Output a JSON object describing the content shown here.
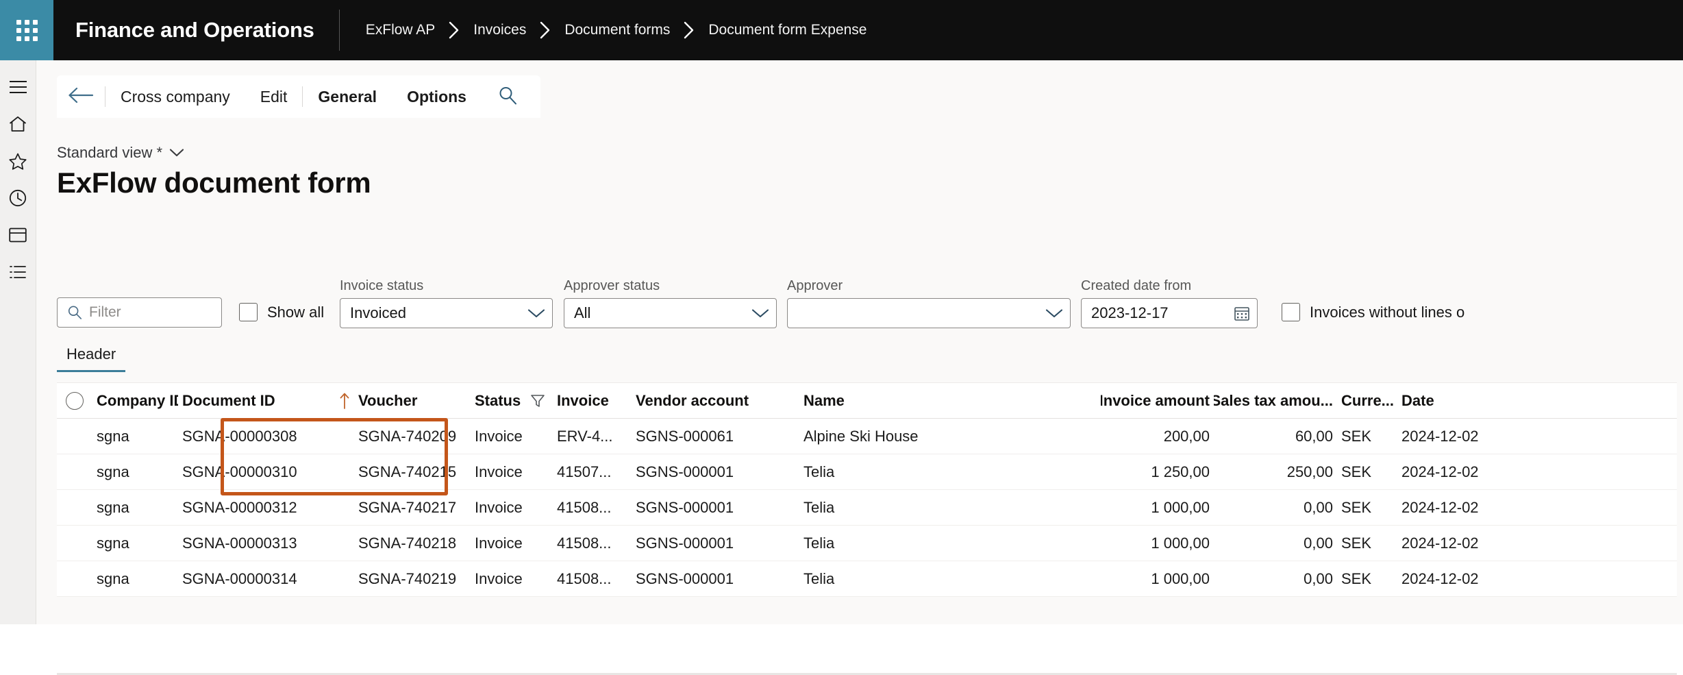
{
  "topbar": {
    "waffle_icon": "app-launcher-icon",
    "app_title": "Finance and Operations",
    "breadcrumb": [
      "ExFlow AP",
      "Invoices",
      "Document forms",
      "Document form Expense"
    ]
  },
  "rail": {
    "items": [
      {
        "name": "hamburger-icon",
        "label": "Expand navigation"
      },
      {
        "name": "home-icon",
        "label": "Home"
      },
      {
        "name": "star-icon",
        "label": "Favorites"
      },
      {
        "name": "clock-icon",
        "label": "Recent"
      },
      {
        "name": "workspaces-icon",
        "label": "Workspaces"
      },
      {
        "name": "modules-icon",
        "label": "Modules"
      }
    ]
  },
  "commandbar": {
    "back_icon": "back-arrow-icon",
    "items": [
      {
        "label": "Cross company",
        "bold": false
      },
      {
        "label": "Edit",
        "bold": false
      },
      {
        "label": "General",
        "bold": true
      },
      {
        "label": "Options",
        "bold": true
      }
    ],
    "search_icon": "search-icon"
  },
  "view": {
    "selector_label": "Standard view *",
    "chevron_icon": "chevron-down-icon",
    "page_title": "ExFlow document form"
  },
  "filters": {
    "filter_placeholder": "Filter",
    "filter_value": "",
    "filter_icon": "search-icon",
    "show_all_label": "Show all",
    "show_all_checked": false,
    "invoice_status": {
      "label": "Invoice status",
      "value": "Invoiced"
    },
    "approver_status": {
      "label": "Approver status",
      "value": "All"
    },
    "approver": {
      "label": "Approver",
      "value": ""
    },
    "created_date_from": {
      "label": "Created date from",
      "value": "2023-12-17",
      "icon": "calendar-icon"
    },
    "invoices_without_lines_label": "Invoices without lines o",
    "invoices_without_lines_checked": false
  },
  "tabs": [
    {
      "label": "Header",
      "active": true
    }
  ],
  "grid": {
    "columns": [
      "Company ID",
      "Document ID",
      "Voucher",
      "Status",
      "Invoice",
      "Vendor account",
      "Name",
      "Invoice amount",
      "Sales tax amou...",
      "Curre...",
      "Date"
    ],
    "sort_indicator_icon": "sort-ascending-icon",
    "status_filter_icon": "filter-funnel-icon",
    "select_all_icon": "radio-unselected-icon",
    "rows": [
      {
        "company_id": "sgna",
        "document_id": "SGNA-00000308",
        "voucher": "SGNA-740209",
        "status": "Invoiced",
        "invoice": "ERV-4...",
        "vendor_account": "SGNS-000061",
        "name": "Alpine Ski House",
        "invoice_amount": "200,00",
        "sales_tax_amount": "60,00",
        "currency": "SEK",
        "date": "2024-12-02"
      },
      {
        "company_id": "sgna",
        "document_id": "SGNA-00000310",
        "voucher": "SGNA-740215",
        "status": "Invoiced",
        "invoice": "41507...",
        "vendor_account": "SGNS-000001",
        "name": "Telia",
        "invoice_amount": "1 250,00",
        "sales_tax_amount": "250,00",
        "currency": "SEK",
        "date": "2024-12-02"
      },
      {
        "company_id": "sgna",
        "document_id": "SGNA-00000312",
        "voucher": "SGNA-740217",
        "status": "Invoiced",
        "invoice": "41508...",
        "vendor_account": "SGNS-000001",
        "name": "Telia",
        "invoice_amount": "1 000,00",
        "sales_tax_amount": "0,00",
        "currency": "SEK",
        "date": "2024-12-02"
      },
      {
        "company_id": "sgna",
        "document_id": "SGNA-00000313",
        "voucher": "SGNA-740218",
        "status": "Invoiced",
        "invoice": "41508...",
        "vendor_account": "SGNS-000001",
        "name": "Telia",
        "invoice_amount": "1 000,00",
        "sales_tax_amount": "0,00",
        "currency": "SEK",
        "date": "2024-12-02"
      },
      {
        "company_id": "sgna",
        "document_id": "SGNA-00000314",
        "voucher": "SGNA-740219",
        "status": "Invoiced",
        "invoice": "41508...",
        "vendor_account": "SGNS-000001",
        "name": "Telia",
        "invoice_amount": "1 000,00",
        "sales_tax_amount": "0,00",
        "currency": "SEK",
        "date": "2024-12-02"
      }
    ]
  },
  "annotation": {
    "highlight_color": "#c4561a",
    "highlight_target": "document-id-and-voucher-first-row"
  },
  "colors": {
    "brand_teal": "#3b8ba6",
    "topbar_bg": "#0f0f0f",
    "page_bg": "#faf9f8",
    "tab_underline": "#3b7d99"
  }
}
